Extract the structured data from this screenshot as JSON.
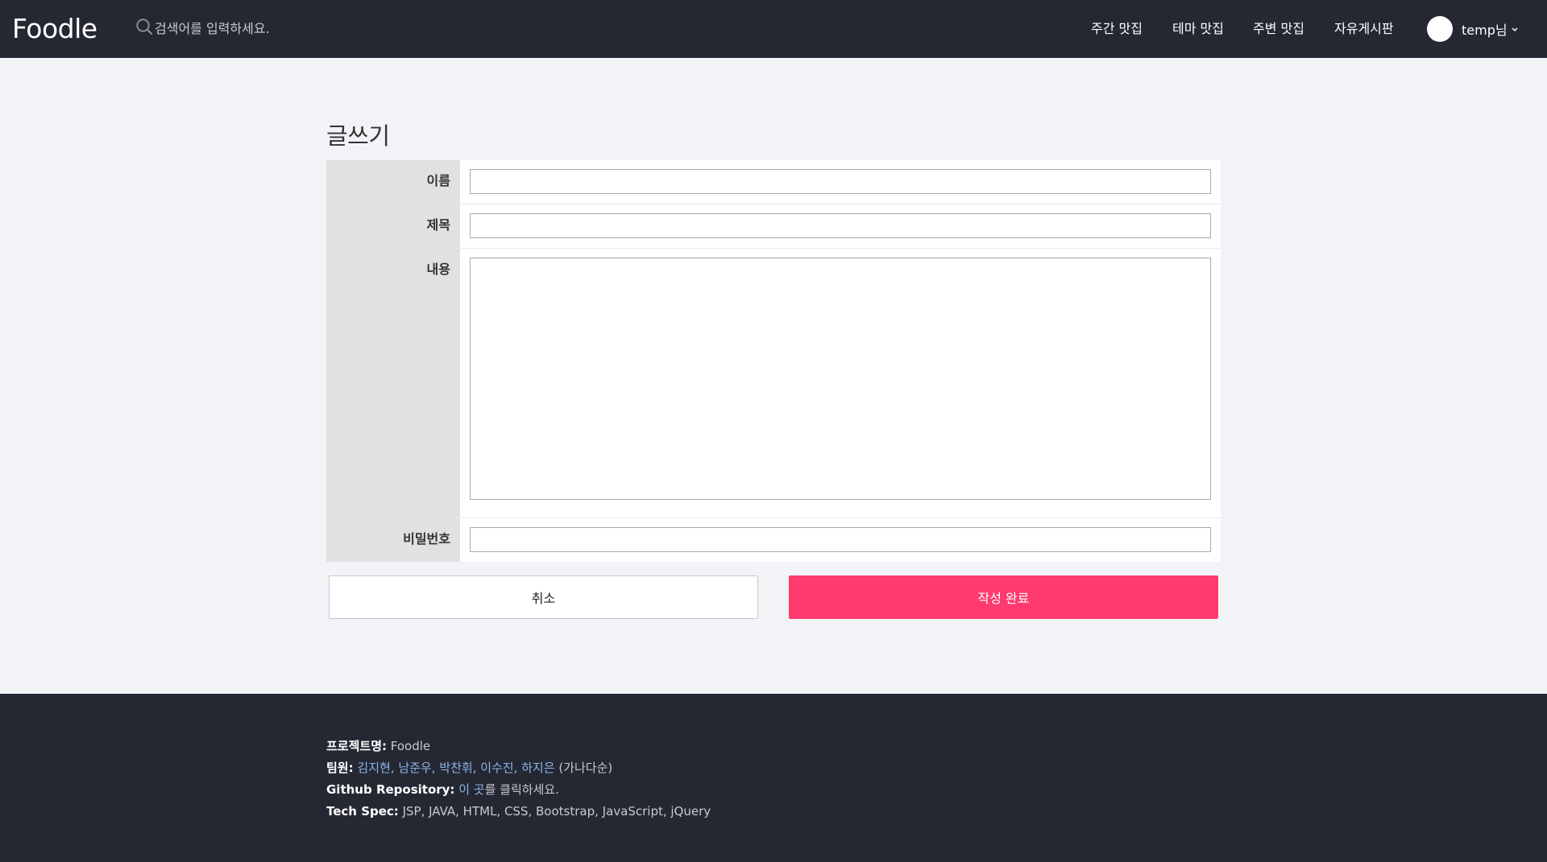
{
  "header": {
    "logo": "Foodle",
    "search_placeholder": "검색어를 입력하세요.",
    "nav": [
      "주간 맛집",
      "테마 맛집",
      "주변 맛집",
      "자유게시판"
    ],
    "user_name": "temp님"
  },
  "page": {
    "title": "글쓰기",
    "fields": {
      "name_label": "이름",
      "subject_label": "제목",
      "content_label": "내용",
      "password_label": "비밀번호"
    },
    "cancel_label": "취소",
    "submit_label": "작성 완료"
  },
  "footer": {
    "project_label": "프로젝트명:",
    "project_value": "Foodle",
    "members_label": "팀원:",
    "members_value": "김지현, 남준우, 박찬휘, 이수진, 하지은",
    "members_note": "(가나다순)",
    "github_label": "Github Repository:",
    "github_link": "이 곳",
    "github_suffix": "를 클릭하세요.",
    "tech_label": "Tech Spec:",
    "tech_value": "JSP, JAVA, HTML, CSS, Bootstrap, JavaScript, jQuery"
  },
  "colors": {
    "header_bg": "#252833",
    "page_bg": "#f2f3f7",
    "accent": "#ff3a6e",
    "label_bg": "#e1e1e1",
    "link": "#8eb4e8"
  }
}
